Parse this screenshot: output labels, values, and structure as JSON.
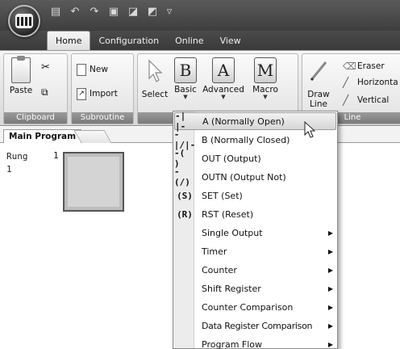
{
  "tabs": [
    {
      "label": "Home",
      "active": true
    },
    {
      "label": "Configuration",
      "active": false
    },
    {
      "label": "Online",
      "active": false
    },
    {
      "label": "View",
      "active": false
    }
  ],
  "ribbon": {
    "clipboard": {
      "group_label": "Clipboard",
      "paste_label": "Paste"
    },
    "subroutine": {
      "group_label": "Subroutine",
      "new_label": "New",
      "import_label": "Import"
    },
    "instructions": {
      "select_label": "Select",
      "basic_label": "Basic",
      "advanced_label": "Advanced",
      "macro_label": "Macro",
      "basic_letter": "B",
      "advanced_letter": "A",
      "macro_letter": "M"
    },
    "line": {
      "group_label": "Line",
      "draw_label_1": "Draw",
      "draw_label_2": "Line",
      "eraser_label": "Eraser",
      "horizontal_label": "Horizonta",
      "vertical_label": "Vertical"
    }
  },
  "document": {
    "tab_label": "Main Program"
  },
  "ladder": {
    "rung_label": "Rung",
    "rung_number": "1",
    "row_number": "1"
  },
  "basic_menu": {
    "items": [
      {
        "icon": "-| |-",
        "label": "A (Normally Open)",
        "submenu": false,
        "highlighted": true
      },
      {
        "icon": "-|/|-",
        "label": "B (Normally Closed)",
        "submenu": false,
        "highlighted": false
      },
      {
        "icon": "-( )",
        "label": "OUT (Output)",
        "submenu": false,
        "highlighted": false
      },
      {
        "icon": "-(/)",
        "label": "OUTN (Output Not)",
        "submenu": false,
        "highlighted": false
      },
      {
        "icon": "(S)",
        "label": "SET (Set)",
        "submenu": false,
        "highlighted": false
      },
      {
        "icon": "(R)",
        "label": "RST (Reset)",
        "submenu": false,
        "highlighted": false
      },
      {
        "icon": "",
        "label": "Single Output",
        "submenu": true,
        "highlighted": false
      },
      {
        "icon": "",
        "label": "Timer",
        "submenu": true,
        "highlighted": false
      },
      {
        "icon": "",
        "label": "Counter",
        "submenu": true,
        "highlighted": false
      },
      {
        "icon": "",
        "label": "Shift Register",
        "submenu": true,
        "highlighted": false
      },
      {
        "icon": "",
        "label": "Counter Comparison",
        "submenu": true,
        "highlighted": false
      },
      {
        "icon": "",
        "label": "Data Register Comparison",
        "submenu": true,
        "highlighted": false
      },
      {
        "icon": "",
        "label": "Program Flow",
        "submenu": true,
        "highlighted": false
      }
    ]
  }
}
